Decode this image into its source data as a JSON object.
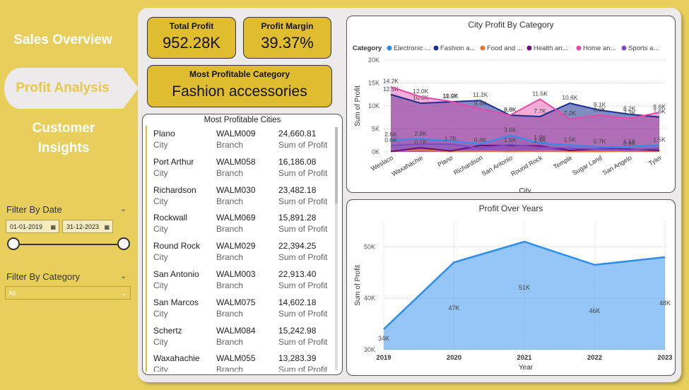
{
  "nav": {
    "sales": "Sales Overview",
    "profit": "Profit Analysis",
    "customer": "Customer Insights"
  },
  "filters": {
    "date_title": "Filter By Date",
    "start_date": "01-01-2019",
    "end_date": "31-12-2023",
    "category_title": "Filter By Category",
    "category_value": "All"
  },
  "kpis": {
    "total_profit_label": "Total Profit",
    "total_profit": "952.28K",
    "margin_label": "Profit Margin",
    "margin": "39.37%",
    "category_label": "Most Profitable Category",
    "category": "Fashion accessories"
  },
  "cities_table": {
    "title": "Most Profitable Cities",
    "sub_city": "City",
    "sub_branch": "Branch",
    "sub_profit": "Sum of Profit",
    "rows": [
      {
        "city": "Plano",
        "branch": "WALM009",
        "profit": "24,660.81"
      },
      {
        "city": "Port Arthur",
        "branch": "WALM058",
        "profit": "16,186.08"
      },
      {
        "city": "Richardson",
        "branch": "WALM030",
        "profit": "23,482.18"
      },
      {
        "city": "Rockwall",
        "branch": "WALM069",
        "profit": "15,891.28"
      },
      {
        "city": "Round Rock",
        "branch": "WALM029",
        "profit": "22,394.25"
      },
      {
        "city": "San Antonio",
        "branch": "WALM003",
        "profit": "22,913.40"
      },
      {
        "city": "San Marcos",
        "branch": "WALM075",
        "profit": "14,602.18"
      },
      {
        "city": "Schertz",
        "branch": "WALM084",
        "profit": "15,242.98"
      },
      {
        "city": "Waxahachie",
        "branch": "WALM055",
        "profit": "13,283.39"
      }
    ]
  },
  "chart_data": [
    {
      "type": "line",
      "title": "City Profit By Category",
      "xlabel": "City",
      "ylabel": "Sum of Profit",
      "legend_title": "Category",
      "legend_position": "top",
      "ylim": [
        0,
        20000
      ],
      "yticks": [
        "0K",
        "5K",
        "10K",
        "15K",
        "20K"
      ],
      "categories": [
        "Weslaco",
        "Waxahachie",
        "Plano",
        "Richardson",
        "San Antonio",
        "Round Rock",
        "Temple",
        "Sugar Land",
        "San Angelo",
        "Tyler"
      ],
      "series": [
        {
          "name": "Electronic ...",
          "color": "#2b8ef0",
          "values": [
            2600,
            2800,
            2400,
            1700,
            3600,
            1900,
            1500,
            1100,
            1100,
            1500
          ],
          "labels": [
            "2.6K",
            "2.8K",
            "",
            "",
            "3.6K",
            "1.9K",
            "1.5K",
            "0.7K",
            "1.1K",
            "1.5K"
          ]
        },
        {
          "name": "Fashion a...",
          "color": "#1a2f8f",
          "values": [
            12500,
            10600,
            10900,
            11200,
            8000,
            7700,
            10600,
            9100,
            8200,
            7600
          ],
          "labels": [
            "12.5K",
            "10.6K",
            "10.9K",
            "11.2K",
            "8.8K",
            "7.7K",
            "10.6K",
            "9.1K",
            "8.2K",
            "7.6K"
          ]
        },
        {
          "name": "Food and ...",
          "color": "#e8772e",
          "values": [
            200,
            400,
            100,
            200,
            100,
            200,
            100,
            100,
            200,
            200
          ],
          "labels": [
            "",
            "",
            "",
            "",
            "",
            "",
            "",
            "",
            "",
            ""
          ]
        },
        {
          "name": "Health an...",
          "color": "#6a0f7a",
          "values": [
            100,
            900,
            200,
            1400,
            1400,
            1300,
            300,
            700,
            600,
            300
          ],
          "labels": [
            "",
            "0.1K",
            "",
            "0.4K",
            "1.5K",
            "1.4K",
            "",
            "",
            "0.9K",
            ""
          ]
        },
        {
          "name": "Home an...",
          "color": "#e64aa8",
          "values": [
            14200,
            12000,
            11000,
            9400,
            8000,
            11500,
            7200,
            8000,
            7300,
            8600
          ],
          "labels": [
            "14.2K",
            "12.0K",
            "11.0K",
            "9.4K",
            "8.0K",
            "11.5K",
            "7.2K",
            "8.0K",
            "7.3K",
            "8.6K"
          ]
        },
        {
          "name": "Sports a...",
          "color": "#7a4dc4",
          "values": [
            1400,
            1700,
            1700,
            800,
            1600,
            1000,
            800,
            600,
            400,
            800
          ],
          "labels": [
            "0.6K",
            "",
            "1.7K",
            "",
            "",
            "",
            "",
            "",
            "",
            ""
          ]
        }
      ]
    },
    {
      "type": "area",
      "title": "Profit Over Years",
      "xlabel": "Year",
      "ylabel": "Sum of Profit",
      "ylim": [
        30000,
        55000
      ],
      "yticks": [
        "30K",
        "40K",
        "50K"
      ],
      "x": [
        "2019",
        "2020",
        "2021",
        "2022",
        "2023"
      ],
      "values": [
        34000,
        47000,
        51000,
        46500,
        48000
      ],
      "labels": [
        "34K",
        "47K",
        "51K",
        "46K",
        "48K"
      ],
      "color": "#2b8ef0"
    }
  ]
}
